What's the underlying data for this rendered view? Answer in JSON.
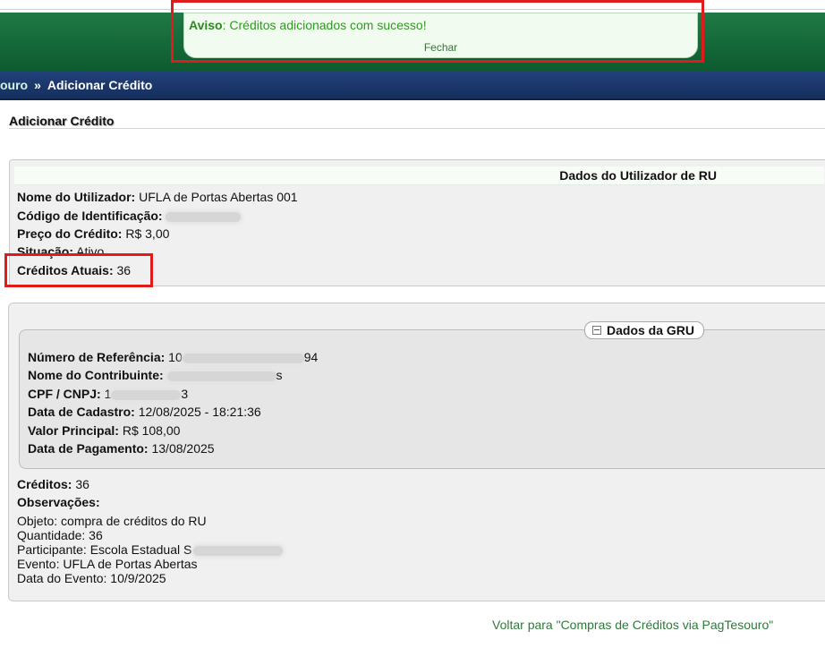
{
  "notice": {
    "label": "Aviso",
    "message": ": Créditos adicionados com sucesso!",
    "close": "Fechar"
  },
  "breadcrumb": {
    "previous": "ouro",
    "separator": "»",
    "current": "Adicionar Crédito"
  },
  "page_title": "Adicionar Crédito",
  "user_panel": {
    "header": "Dados do Utilizador de RU",
    "name_label": "Nome do Utilizador:",
    "name_value": "UFLA de Portas Abertas 001",
    "id_label": "Código de Identificação:",
    "price_label": "Preço do Crédito:",
    "price_value": "R$ 3,00",
    "status_label": "Situação:",
    "status_value": "Ativo",
    "credits_label": "Créditos Atuais:",
    "credits_value": "36"
  },
  "gru": {
    "legend": "Dados da GRU",
    "ref_label": "Número de Referência:",
    "ref_prefix": "10",
    "ref_suffix": "94",
    "contrib_label": "Nome do Contribuinte:",
    "contrib_suffix": "s",
    "cpf_label": "CPF / CNPJ:",
    "cpf_prefix": "1",
    "cpf_suffix": "3",
    "date_label": "Data de Cadastro:",
    "date_value": "12/08/2025 - 18:21:36",
    "value_label": "Valor Principal:",
    "value_value": "R$ 108,00",
    "paydate_label": "Data de Pagamento:",
    "paydate_value": "13/08/2025"
  },
  "summary": {
    "credits_label": "Créditos:",
    "credits_value": "36",
    "obs_label": "Observações:",
    "obs_lines": [
      "Objeto: compra de créditos do RU",
      "Quantidade: 36",
      "Participante: Escola Estadual S",
      "Evento: UFLA de Portas Abertas",
      "Data do Evento: 10/9/2025"
    ]
  },
  "back_link": "Voltar para \"Compras de Créditos via PagTesouro\""
}
